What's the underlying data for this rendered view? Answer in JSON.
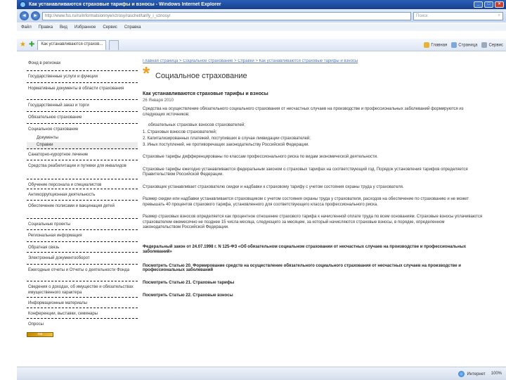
{
  "window": {
    "title": "Как устанавливаются страховые тарифы и взносы - Windows Internet Explorer",
    "min_label": "_",
    "max_label": "□",
    "close_label": "×"
  },
  "address": {
    "back_label": "◄",
    "forward_label": "►",
    "url": "http://www.fss.ru/ru/informatsionnye/vzrosy/raschet/tarify_i_vznosy/",
    "search_placeholder": "Поиск",
    "search_icon_label": "⌕"
  },
  "menu": [
    "Файл",
    "Правка",
    "Вид",
    "Избранное",
    "Сервис",
    "Справка"
  ],
  "favbar": {
    "tab_active": "Как устанавливаются страхов...",
    "tab_new": "",
    "tools": [
      "Главная",
      "Страница",
      "Сервис"
    ]
  },
  "sidebar": {
    "items": [
      {
        "label": "Фонд в регионах",
        "sub": false,
        "active": false
      },
      {
        "label": "Государственные услуги и функции",
        "sub": false,
        "active": false
      },
      {
        "label": "Нормативные документы в области страхования",
        "sub": false,
        "active": false
      },
      {
        "label": "Государственный заказ и торги",
        "sub": false,
        "active": false
      },
      {
        "label": "Обязательное страхование",
        "sub": false,
        "active": false
      },
      {
        "label": "Социальное страхование",
        "sub": false,
        "active": false
      },
      {
        "label": "Документы",
        "sub": true,
        "active": false
      },
      {
        "label": "Справки",
        "sub": true,
        "active": true
      },
      {
        "label": "Санаторно-курортное лечение",
        "sub": false,
        "active": false
      },
      {
        "label": "Средства реабилитации и путевки для инвалидов",
        "sub": false,
        "active": false
      },
      {
        "label": "Обучение персонала и специалистов",
        "sub": false,
        "active": false
      },
      {
        "label": "Антикоррупционная деятельность",
        "sub": false,
        "active": false
      },
      {
        "label": "Обеспечение полисами и вакцинация детей",
        "sub": false,
        "active": false
      },
      {
        "label": "Социальные проекты",
        "sub": false,
        "active": false
      },
      {
        "label": "Региональная информация",
        "sub": false,
        "active": false
      },
      {
        "label": "Обратная связь",
        "sub": false,
        "active": false
      },
      {
        "label": "Электронный документооборот",
        "sub": false,
        "active": false
      },
      {
        "label": "Ежегодные отчеты и Отчеты о деятельности Фонда",
        "sub": false,
        "active": false
      },
      {
        "label": "Сведения о доходах, об имуществе и обязательствах имущественного характера",
        "sub": false,
        "active": false
      },
      {
        "label": "Информационные материалы",
        "sub": false,
        "active": false
      },
      {
        "label": "Конференции, выставки, семинары",
        "sub": false,
        "active": false
      },
      {
        "label": "Опросы",
        "sub": false,
        "active": false
      }
    ],
    "badge": "rss"
  },
  "main": {
    "breadcrumb": "Главная страница > Социальное страхование > Справки > Как устанавливаются страховые тарифы и взносы",
    "page_title": "Социальное страхование",
    "article_title": "Как устанавливаются страховые тарифы и взносы",
    "date": "26 Января 2010",
    "para1": "Средства на осуществление обязательного социального страхования от несчастных случаев на производстве и профессиональных заболеваний формируются из следующих источников:",
    "list_title": "обязательных страховых взносов страхователей;",
    "list": [
      "1. Страховых взносов страхователей;",
      "2. Капитализированных платежей, поступивших в случае ликвидации страхователей;",
      "3. Иных поступлений, не противоречащих законодательству Российской Федерации."
    ],
    "para2": "Страховые тарифы дифференцированы по классам профессионального риска по видам экономической деятельности.",
    "para3": "Страховые тарифы ежегодно устанавливаются федеральным законом о страховых тарифах на соответствующий год. Порядок установления тарифов определяется Правительством Российской Федерации.",
    "para4": "Страховщик устанавливает страхователю скидки и надбавки к страховому тарифу с учетом состояния охраны труда у страхователя.",
    "para5": "Размер скидки или надбавки устанавливается страховщиком с учетом состояния охраны труда у страхователя, расходов на обеспечение по страхованию и не может превышать 40 процентов страхового тарифа, установленного для соответствующего класса профессионального риска.",
    "para6": "Размер страховых взносов определяется как процентное отношение страхового тарифа к начисленной оплате труда по всем основаниям. Страховые взносы уплачиваются страхователем ежемесячно не позднее 15 числа месяца, следующего за месяцем, за который начисляются страховые взносы, в порядке, определенном законодательством Российской Федерации.",
    "law": "Федеральный закон от 24.07.1998 г. N 125-ФЗ «Об обязательном социальном страховании от несчастных случаев на производстве и профессиональных заболеваний»",
    "link1": "Посмотреть Статью 20. Формирование средств на осуществление обязательного социального страхования от несчастных случаев на производстве и профессиональных заболеваний",
    "link2": "Посмотреть Статью 21. Страховые тарифы",
    "link3": "Посмотреть Статью 22. Страховые взносы"
  },
  "status": {
    "zone": "Интернет",
    "zoom": "100%"
  }
}
